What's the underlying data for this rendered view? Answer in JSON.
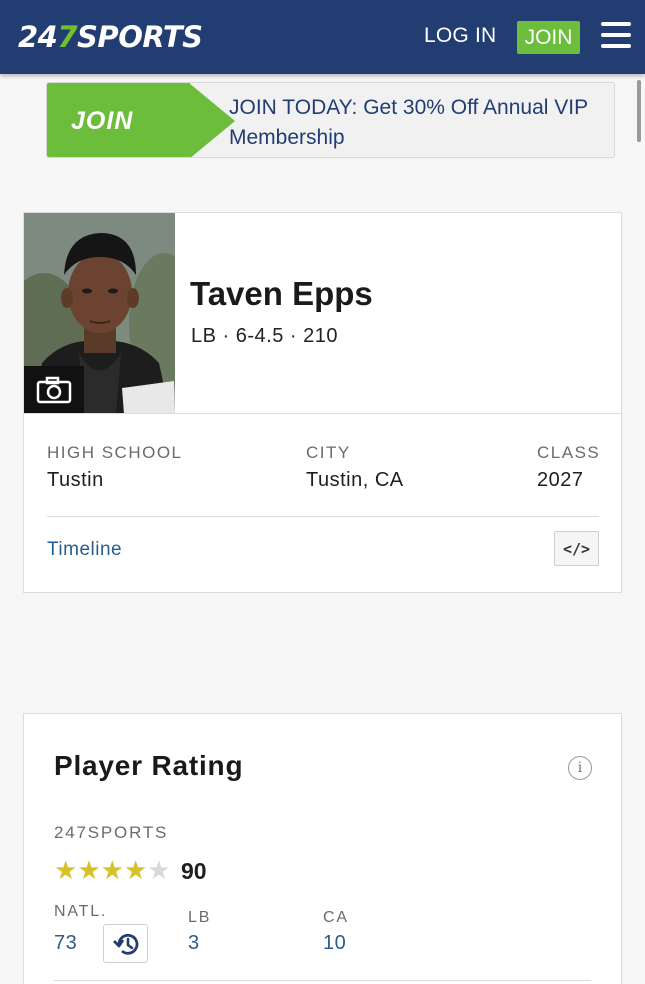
{
  "header": {
    "logo": {
      "part1": "24",
      "part2": "7",
      "part3": "SPORTS"
    },
    "login_label": "LOG IN",
    "join_label": "JOIN",
    "menu_icon": "hamburger-menu-icon"
  },
  "promo": {
    "join_label": "JOIN",
    "text": "JOIN TODAY: Get 30% Off Annual VIP Membership"
  },
  "player": {
    "name": "Taven Epps",
    "meta": "LB · 6-4.5 · 210",
    "camera_icon": "camera-icon",
    "info": [
      {
        "label": "HIGH SCHOOL",
        "value": "Tustin"
      },
      {
        "label": "CITY",
        "value": "Tustin, CA"
      },
      {
        "label": "CLASS",
        "value": "2027"
      }
    ],
    "timeline_label": "Timeline",
    "embed_label": "</>"
  },
  "rating": {
    "title": "Player Rating",
    "info_icon_label": "i",
    "source_label": "247SPORTS",
    "stars_filled": 4,
    "stars_total": 5,
    "score": "90",
    "rankings": [
      {
        "label": "NATL.",
        "value": "73"
      },
      {
        "label": "LB",
        "value": "3"
      },
      {
        "label": "CA",
        "value": "10"
      }
    ]
  },
  "colors": {
    "header_bg": "#213d72",
    "brand_green": "#6cbd3c",
    "link_blue": "#2a5d8c",
    "star_gold": "#d6c22a"
  }
}
